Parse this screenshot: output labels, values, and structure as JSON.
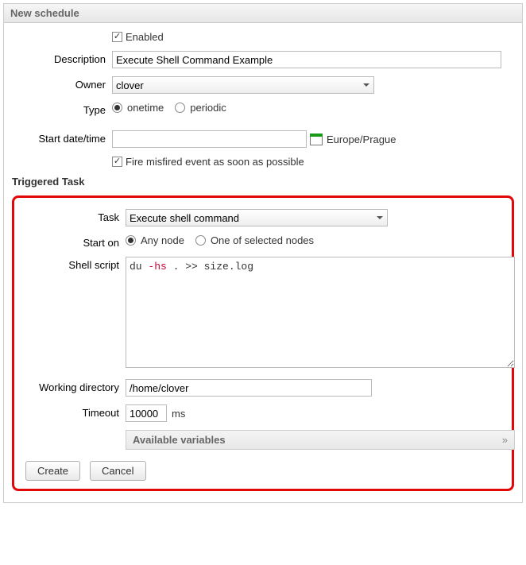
{
  "panel_title": "New schedule",
  "labels": {
    "enabled": "Enabled",
    "description": "Description",
    "owner": "Owner",
    "type": "Type",
    "start_dt": "Start date/time",
    "fire_misfired": "Fire misfired event as soon as possible",
    "triggered_task": "Triggered Task",
    "task": "Task",
    "start_on": "Start on",
    "shell_script": "Shell script",
    "working_dir": "Working directory",
    "timeout": "Timeout",
    "ms": "ms",
    "avail_vars": "Available variables",
    "create": "Create",
    "cancel": "Cancel"
  },
  "values": {
    "enabled": true,
    "description": "Execute Shell Command Example",
    "owner": "clover",
    "type_onetime": "onetime",
    "type_periodic": "periodic",
    "type_selected": "onetime",
    "start_dt": "",
    "timezone": "Europe/Prague",
    "fire_misfired": true,
    "task": "Execute shell command",
    "start_on_any": "Any node",
    "start_on_sel": "One of selected nodes",
    "start_on_selected": "any",
    "shell_script_pre": "du ",
    "shell_script_kw": "-hs",
    "shell_script_post": " . >> size.log",
    "shell_script_full": "du -hs . >> size.log",
    "working_dir": "/home/clover",
    "timeout": "10000"
  },
  "expand_glyph": "»"
}
